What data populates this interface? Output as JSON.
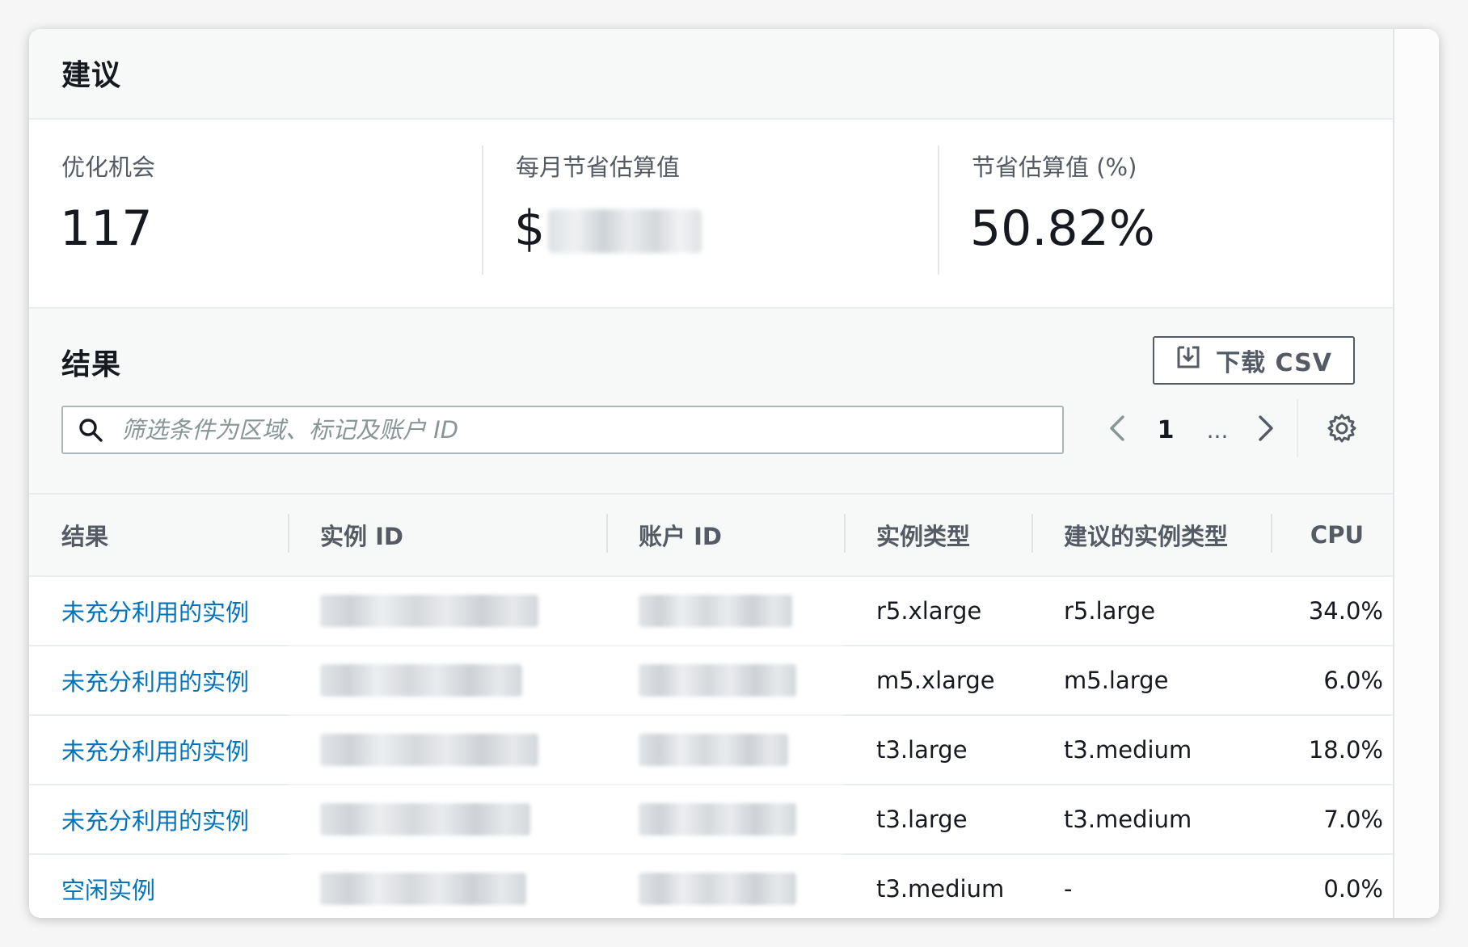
{
  "recommendations": {
    "title": "建议"
  },
  "summary": {
    "opportunities_label": "优化机会",
    "opportunities_value": "117",
    "monthly_savings_label": "每月节省估算值",
    "monthly_savings_prefix": "$",
    "savings_pct_label": "节省估算值 (%)",
    "savings_pct_value": "50.82%"
  },
  "results": {
    "title": "结果",
    "download_label": "下载 CSV",
    "search_placeholder": "筛选条件为区域、标记及账户 ID",
    "pagination": {
      "current_page": "1",
      "ellipsis": "..."
    }
  },
  "table": {
    "columns": [
      "结果",
      "实例 ID",
      "账户 ID",
      "实例类型",
      "建议的实例类型",
      "CPU"
    ],
    "rows": [
      {
        "finding": "未充分利用的实例",
        "instance_type": "r5.xlarge",
        "recommended_type": "r5.large",
        "cpu": "34.0%"
      },
      {
        "finding": "未充分利用的实例",
        "instance_type": "m5.xlarge",
        "recommended_type": "m5.large",
        "cpu": "6.0%"
      },
      {
        "finding": "未充分利用的实例",
        "instance_type": "t3.large",
        "recommended_type": "t3.medium",
        "cpu": "18.0%"
      },
      {
        "finding": "未充分利用的实例",
        "instance_type": "t3.large",
        "recommended_type": "t3.medium",
        "cpu": "7.0%"
      },
      {
        "finding": "空闲实例",
        "instance_type": "t3.medium",
        "recommended_type": "-",
        "cpu": "0.0%"
      }
    ]
  },
  "colors": {
    "link": "#0073bb",
    "text": "#16191f",
    "muted": "#545b64",
    "header_bg": "#f7f8f8"
  },
  "icons": {
    "download": "download-icon",
    "search": "search-icon",
    "prev": "chevron-left-icon",
    "next": "chevron-right-icon",
    "settings": "gear-icon"
  }
}
